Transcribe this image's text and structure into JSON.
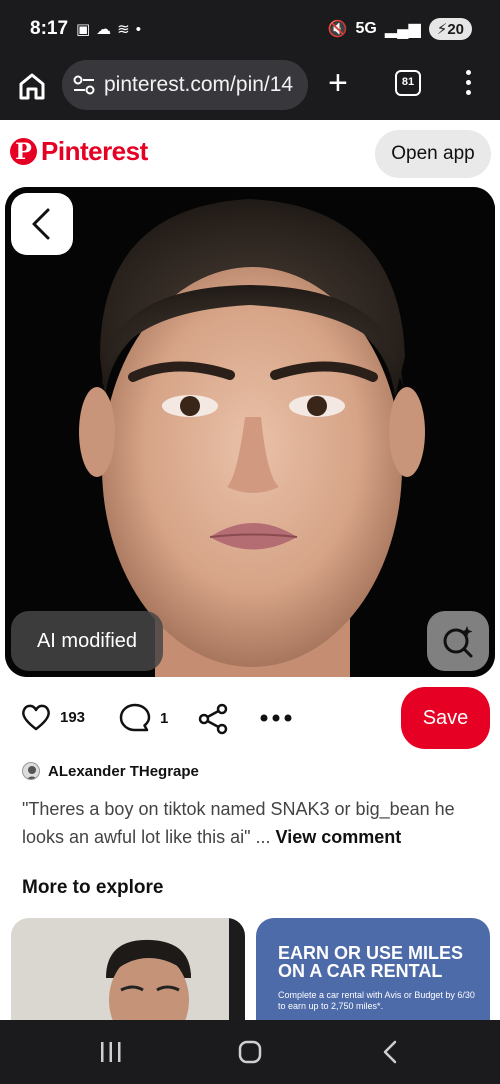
{
  "status_bar": {
    "time": "8:17",
    "network": "5G",
    "battery": "20"
  },
  "browser": {
    "url": "pinterest.com/pin/14",
    "tab_count": "81"
  },
  "pinterest": {
    "logo_text": "Pinterest",
    "open_app_label": "Open app"
  },
  "pin": {
    "ai_badge": "AI modified",
    "likes": "193",
    "comments": "1",
    "save_label": "Save"
  },
  "comment": {
    "author": "ALexander THegrape",
    "text": "\"Theres a boy on tiktok named SNAK3 or big_bean he looks an awful lot like this ai\" ...",
    "view_link": "View comment"
  },
  "explore": {
    "title": "More to explore",
    "card2_headline": "EARN OR USE MILES ON A CAR RENTAL",
    "card2_sub": "Complete a car rental with Avis or Budget by 6/30 to earn up to 2,750 miles*."
  },
  "colors": {
    "brand_red": "#e60023",
    "chrome_dark": "#1b1b1d"
  }
}
